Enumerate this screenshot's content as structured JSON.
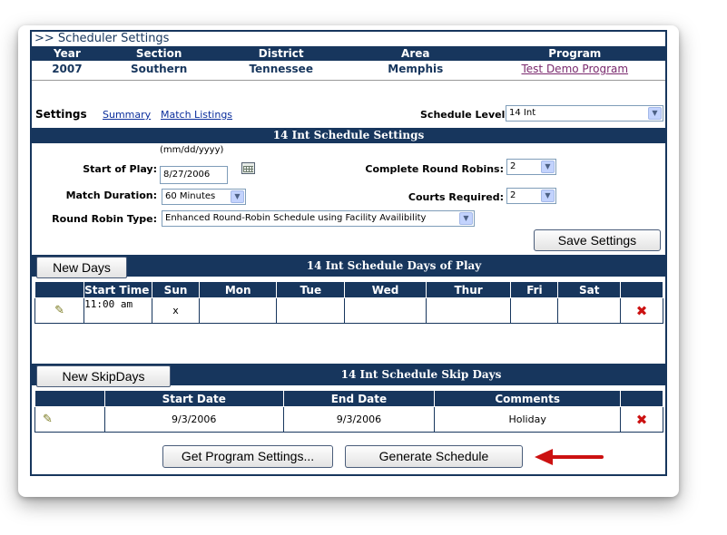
{
  "header": {
    "title": ">> Scheduler Settings",
    "columns": [
      "Year",
      "Section",
      "District",
      "Area",
      "Program"
    ],
    "values": [
      "2007",
      "Southern",
      "Tennessee",
      "Memphis"
    ],
    "program_link": "Test Demo Program"
  },
  "tabs": {
    "active": "Settings",
    "summary": "Summary",
    "match_listings": "Match Listings"
  },
  "schedule_level": {
    "label": "Schedule Level:",
    "value": "14 Int"
  },
  "settings": {
    "title": "14 Int Schedule Settings",
    "date_hint": "(mm/dd/yyyy)",
    "start_of_play_label": "Start of Play:",
    "start_of_play_value": "8/27/2006",
    "match_duration_label": "Match Duration:",
    "match_duration_value": "60 Minutes",
    "round_robin_label": "Round Robin Type:",
    "round_robin_value": "Enhanced Round-Robin Schedule using Facility Availibility",
    "complete_rr_label": "Complete Round Robins:",
    "complete_rr_value": "2",
    "courts_label": "Courts Required:",
    "courts_value": "2",
    "save_button": "Save Settings"
  },
  "days": {
    "new_button": "New Days",
    "title": "14 Int Schedule Days of Play",
    "columns": [
      "",
      "Start Time",
      "Sun",
      "Mon",
      "Tue",
      "Wed",
      "Thur",
      "Fri",
      "Sat",
      ""
    ],
    "rows": [
      {
        "start_time": "11:00 am",
        "sun": "x",
        "mon": "",
        "tue": "",
        "wed": "",
        "thur": "",
        "fri": "",
        "sat": ""
      }
    ]
  },
  "skipdays": {
    "new_button": "New SkipDays",
    "title": "14 Int Schedule Skip Days",
    "columns": [
      "",
      "Start Date",
      "End Date",
      "Comments",
      ""
    ],
    "rows": [
      {
        "start_date": "9/3/2006",
        "end_date": "9/3/2006",
        "comments": "Holiday"
      }
    ]
  },
  "footer": {
    "get_settings_button": "Get Program Settings...",
    "generate_button": "Generate Schedule"
  },
  "colors": {
    "navy": "#17365d",
    "accent_red": "#cc1111",
    "link": "#0b2e9c"
  }
}
